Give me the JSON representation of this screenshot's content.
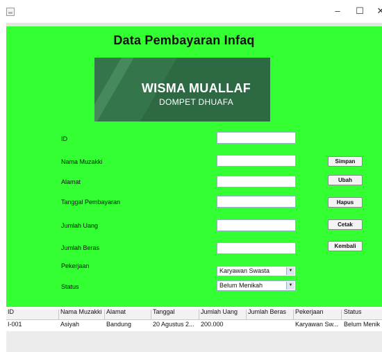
{
  "window": {
    "minimize": "–",
    "maximize": "☐",
    "close": "✕"
  },
  "form": {
    "title": "Data Pembayaran Infaq",
    "logo_line1": "WISMA MUALLAF",
    "logo_line2": "DOMPET DHUAFA"
  },
  "fields": {
    "id_label": "ID",
    "nama_label": "Nama Muzakki",
    "alamat_label": "Alamat",
    "tanggal_label": "Tanggal Pembayaran",
    "jumlah_uang_label": "Jumlah Uang",
    "jumlah_beras_label": "Jumlah Beras",
    "pekerjaan_label": "Pekerjaan",
    "status_label": "Status",
    "id_value": "",
    "nama_value": "",
    "alamat_value": "",
    "tanggal_value": "",
    "jumlah_uang_value": "",
    "jumlah_beras_value": "",
    "pekerjaan_selected": "Karyawan Swasta",
    "status_selected": "Belum Menikah"
  },
  "buttons": {
    "simpan": "Simpan",
    "ubah": "Ubah",
    "hapus": "Hapus",
    "cetak": "Cetak",
    "kembali": "Kembali"
  },
  "table": {
    "headers": [
      "ID",
      "Nama Muzakki",
      "Alamat",
      "Tanggal",
      "Jumlah Uang",
      "Jumlah Beras",
      "Pekerjaan",
      "Status"
    ],
    "rows": [
      [
        "I-001",
        "Asiyah",
        "Bandung",
        "20 Agustus 2...",
        "200.000",
        "",
        "Karyawan Sw...",
        "Belum Menik"
      ]
    ]
  },
  "colors": {
    "panel_bg": "#33ff33",
    "logo_bg": "#2d6a43"
  }
}
